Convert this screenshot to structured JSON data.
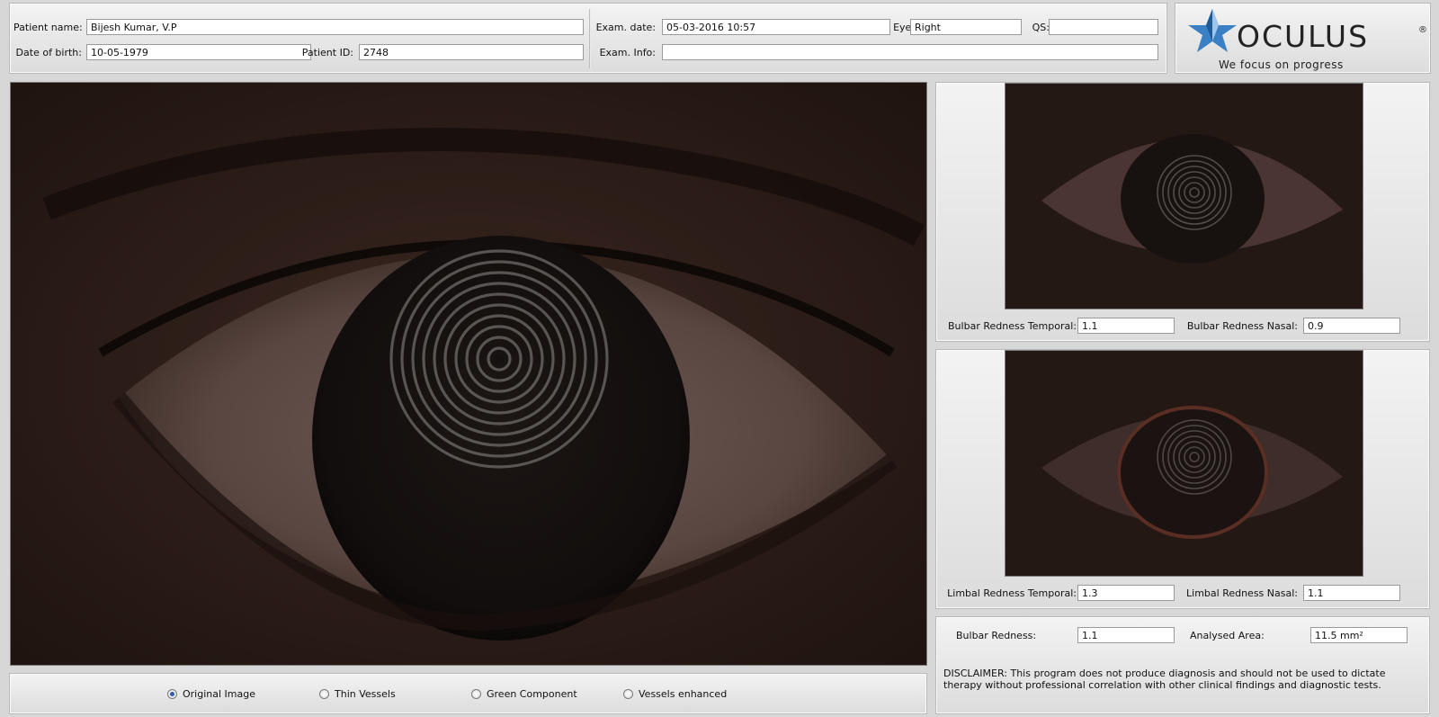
{
  "header": {
    "patient_name_label": "Patient name:",
    "patient_name": "Bijesh Kumar, V.P",
    "dob_label": "Date of birth:",
    "dob": "10-05-1979",
    "patient_id_label": "Patient ID:",
    "patient_id": "2748",
    "exam_date_label": "Exam. date:",
    "exam_date": "05-03-2016 10:57",
    "eye_label": "Eye:",
    "eye": "Right",
    "qs_label": "QS:",
    "qs": "",
    "exam_info_label": "Exam. Info:",
    "exam_info": ""
  },
  "logo": {
    "brand": "OCULUS",
    "registered": "®",
    "tagline": "We focus on progress",
    "star_color": "#3b7fc4"
  },
  "bulbar_panel": {
    "temporal_label": "Bulbar Redness Temporal:",
    "temporal_value": "1.1",
    "nasal_label": "Bulbar Redness Nasal:",
    "nasal_value": "0.9"
  },
  "limbal_panel": {
    "temporal_label": "Limbal Redness Temporal:",
    "temporal_value": "1.3",
    "nasal_label": "Limbal Redness Nasal:",
    "nasal_value": "1.1"
  },
  "summary": {
    "bulbar_label": "Bulbar Redness:",
    "bulbar_value": "1.1",
    "area_label": "Analysed Area:",
    "area_value": "11.5 mm²",
    "disclaimer": "DISCLAIMER: This program does not produce diagnosis and should not be used to dictate therapy without professional correlation with other clinical findings and diagnostic tests."
  },
  "view_options": {
    "selected": "Original Image",
    "items": [
      "Original Image",
      "Thin Vessels",
      "Green Component",
      "Vessels enhanced"
    ]
  }
}
